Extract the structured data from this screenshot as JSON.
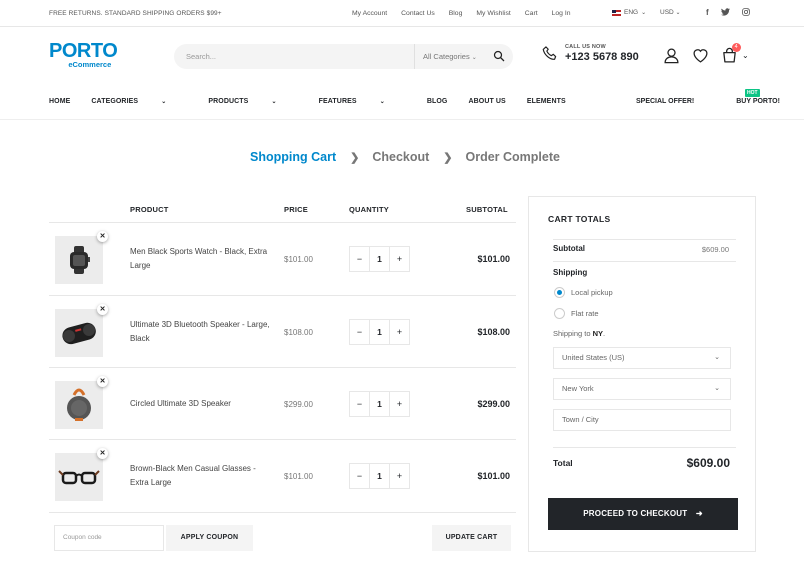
{
  "topbar": {
    "promo": "FREE RETURNS. STANDARD SHIPPING ORDERS $99+",
    "links": [
      "My Account",
      "Contact Us",
      "Blog",
      "My Wishlist",
      "Cart",
      "Log In"
    ],
    "language": "ENG",
    "currency": "USD"
  },
  "header": {
    "logo_main": "PORTO",
    "logo_sub": "eCommerce",
    "search_placeholder": "Search...",
    "category_select": "All Categories",
    "call_label": "CALL US NOW",
    "call_number": "+123 5678 890",
    "cart_count": "4"
  },
  "nav": {
    "items": [
      "HOME",
      "CATEGORIES",
      "PRODUCTS",
      "FEATURES",
      "BLOG",
      "ABOUT US",
      "ELEMENTS"
    ],
    "special_offer": "SPECIAL OFFER!",
    "buy_porto": "BUY PORTO!",
    "hot_badge": "HOT"
  },
  "steps": [
    "Shopping Cart",
    "Checkout",
    "Order Complete"
  ],
  "cart": {
    "headers": {
      "product": "PRODUCT",
      "price": "PRICE",
      "quantity": "QUANTITY",
      "subtotal": "SUBTOTAL"
    },
    "items": [
      {
        "name": "Men Black Sports Watch - Black, Extra Large",
        "price": "$101.00",
        "qty": "1",
        "subtotal": "$101.00",
        "icon": "watch-icon"
      },
      {
        "name": "Ultimate 3D Bluetooth Speaker - Large, Black",
        "price": "$108.00",
        "qty": "1",
        "subtotal": "$108.00",
        "icon": "speaker-icon"
      },
      {
        "name": "Circled Ultimate 3D Speaker",
        "price": "$299.00",
        "qty": "1",
        "subtotal": "$299.00",
        "icon": "round-speaker-icon"
      },
      {
        "name": "Brown-Black Men Casual Glasses - Extra Large",
        "price": "$101.00",
        "qty": "1",
        "subtotal": "$101.00",
        "icon": "glasses-icon"
      }
    ],
    "coupon_placeholder": "Coupon code",
    "apply_coupon": "APPLY COUPON",
    "update_cart": "UPDATE CART"
  },
  "totals": {
    "title": "CART TOTALS",
    "subtotal_label": "Subtotal",
    "subtotal_value": "$609.00",
    "shipping_label": "Shipping",
    "options": [
      "Local pickup",
      "Flat rate"
    ],
    "shipping_to_prefix": "Shipping to",
    "shipping_to_state": "NY",
    "shipping_to_suffix": ".",
    "country": "United States (US)",
    "state": "New York",
    "city_placeholder": "Town / City",
    "total_label": "Total",
    "total_value": "$609.00",
    "checkout_button": "PROCEED TO CHECKOUT"
  },
  "colors": {
    "accent": "#0088cc",
    "dark": "#222529",
    "badge": "#ff5b5b",
    "hot": "#0cc485"
  }
}
